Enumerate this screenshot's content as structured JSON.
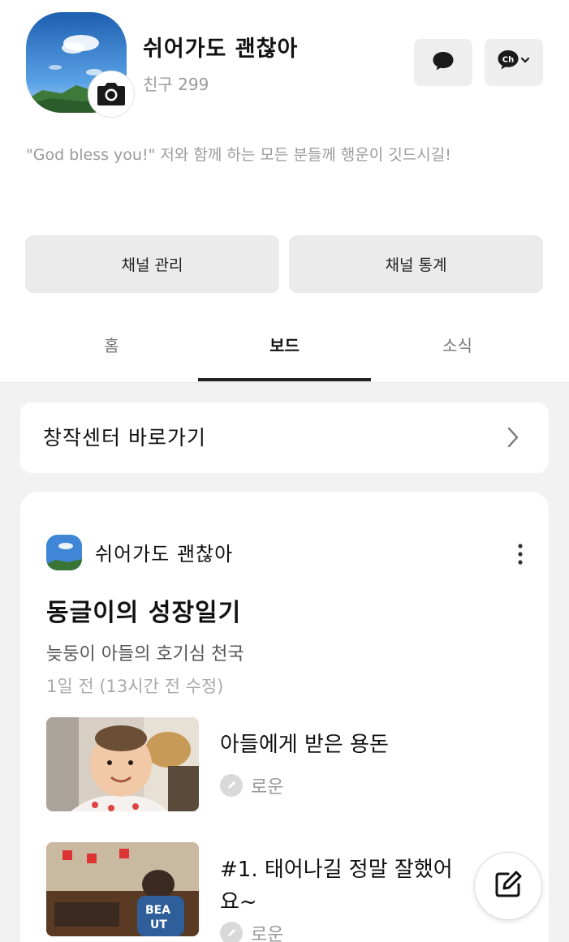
{
  "profile": {
    "name": "쉬어가도 괜찮아",
    "friends": "친구 299",
    "status": "\"God bless you!\" 저와 함께 하는 모든 분들께 행운이 깃드시길!",
    "icons": [
      "camera-icon",
      "chat-bubble-icon",
      "channel-icon"
    ]
  },
  "buttons": {
    "manage": "채널 관리",
    "stats": "채널 통계"
  },
  "tabs": [
    {
      "label": "홈",
      "active": false
    },
    {
      "label": "보드",
      "active": true
    },
    {
      "label": "소식",
      "active": false
    }
  ],
  "creator": {
    "label": "창작센터 바로가기",
    "icon": "chevron-right-icon"
  },
  "post": {
    "author": "쉬어가도 괜찮아",
    "title": "동글이의 성장일기",
    "subtitle": "늦둥이 아들의 호기심 천국",
    "time": "1일 전 (13시간 전 수정)",
    "items": [
      {
        "title": "아들에게 받은 용돈",
        "author": "로운"
      },
      {
        "title": "#1. 태어나길 정말 잘했어요~",
        "author": "로운"
      }
    ]
  },
  "fab": {
    "icon": "edit-icon"
  },
  "colors": {
    "background": "#f2f2f2",
    "button": "#ebebeb",
    "text": "#111111",
    "muted": "#9a9a9a"
  }
}
